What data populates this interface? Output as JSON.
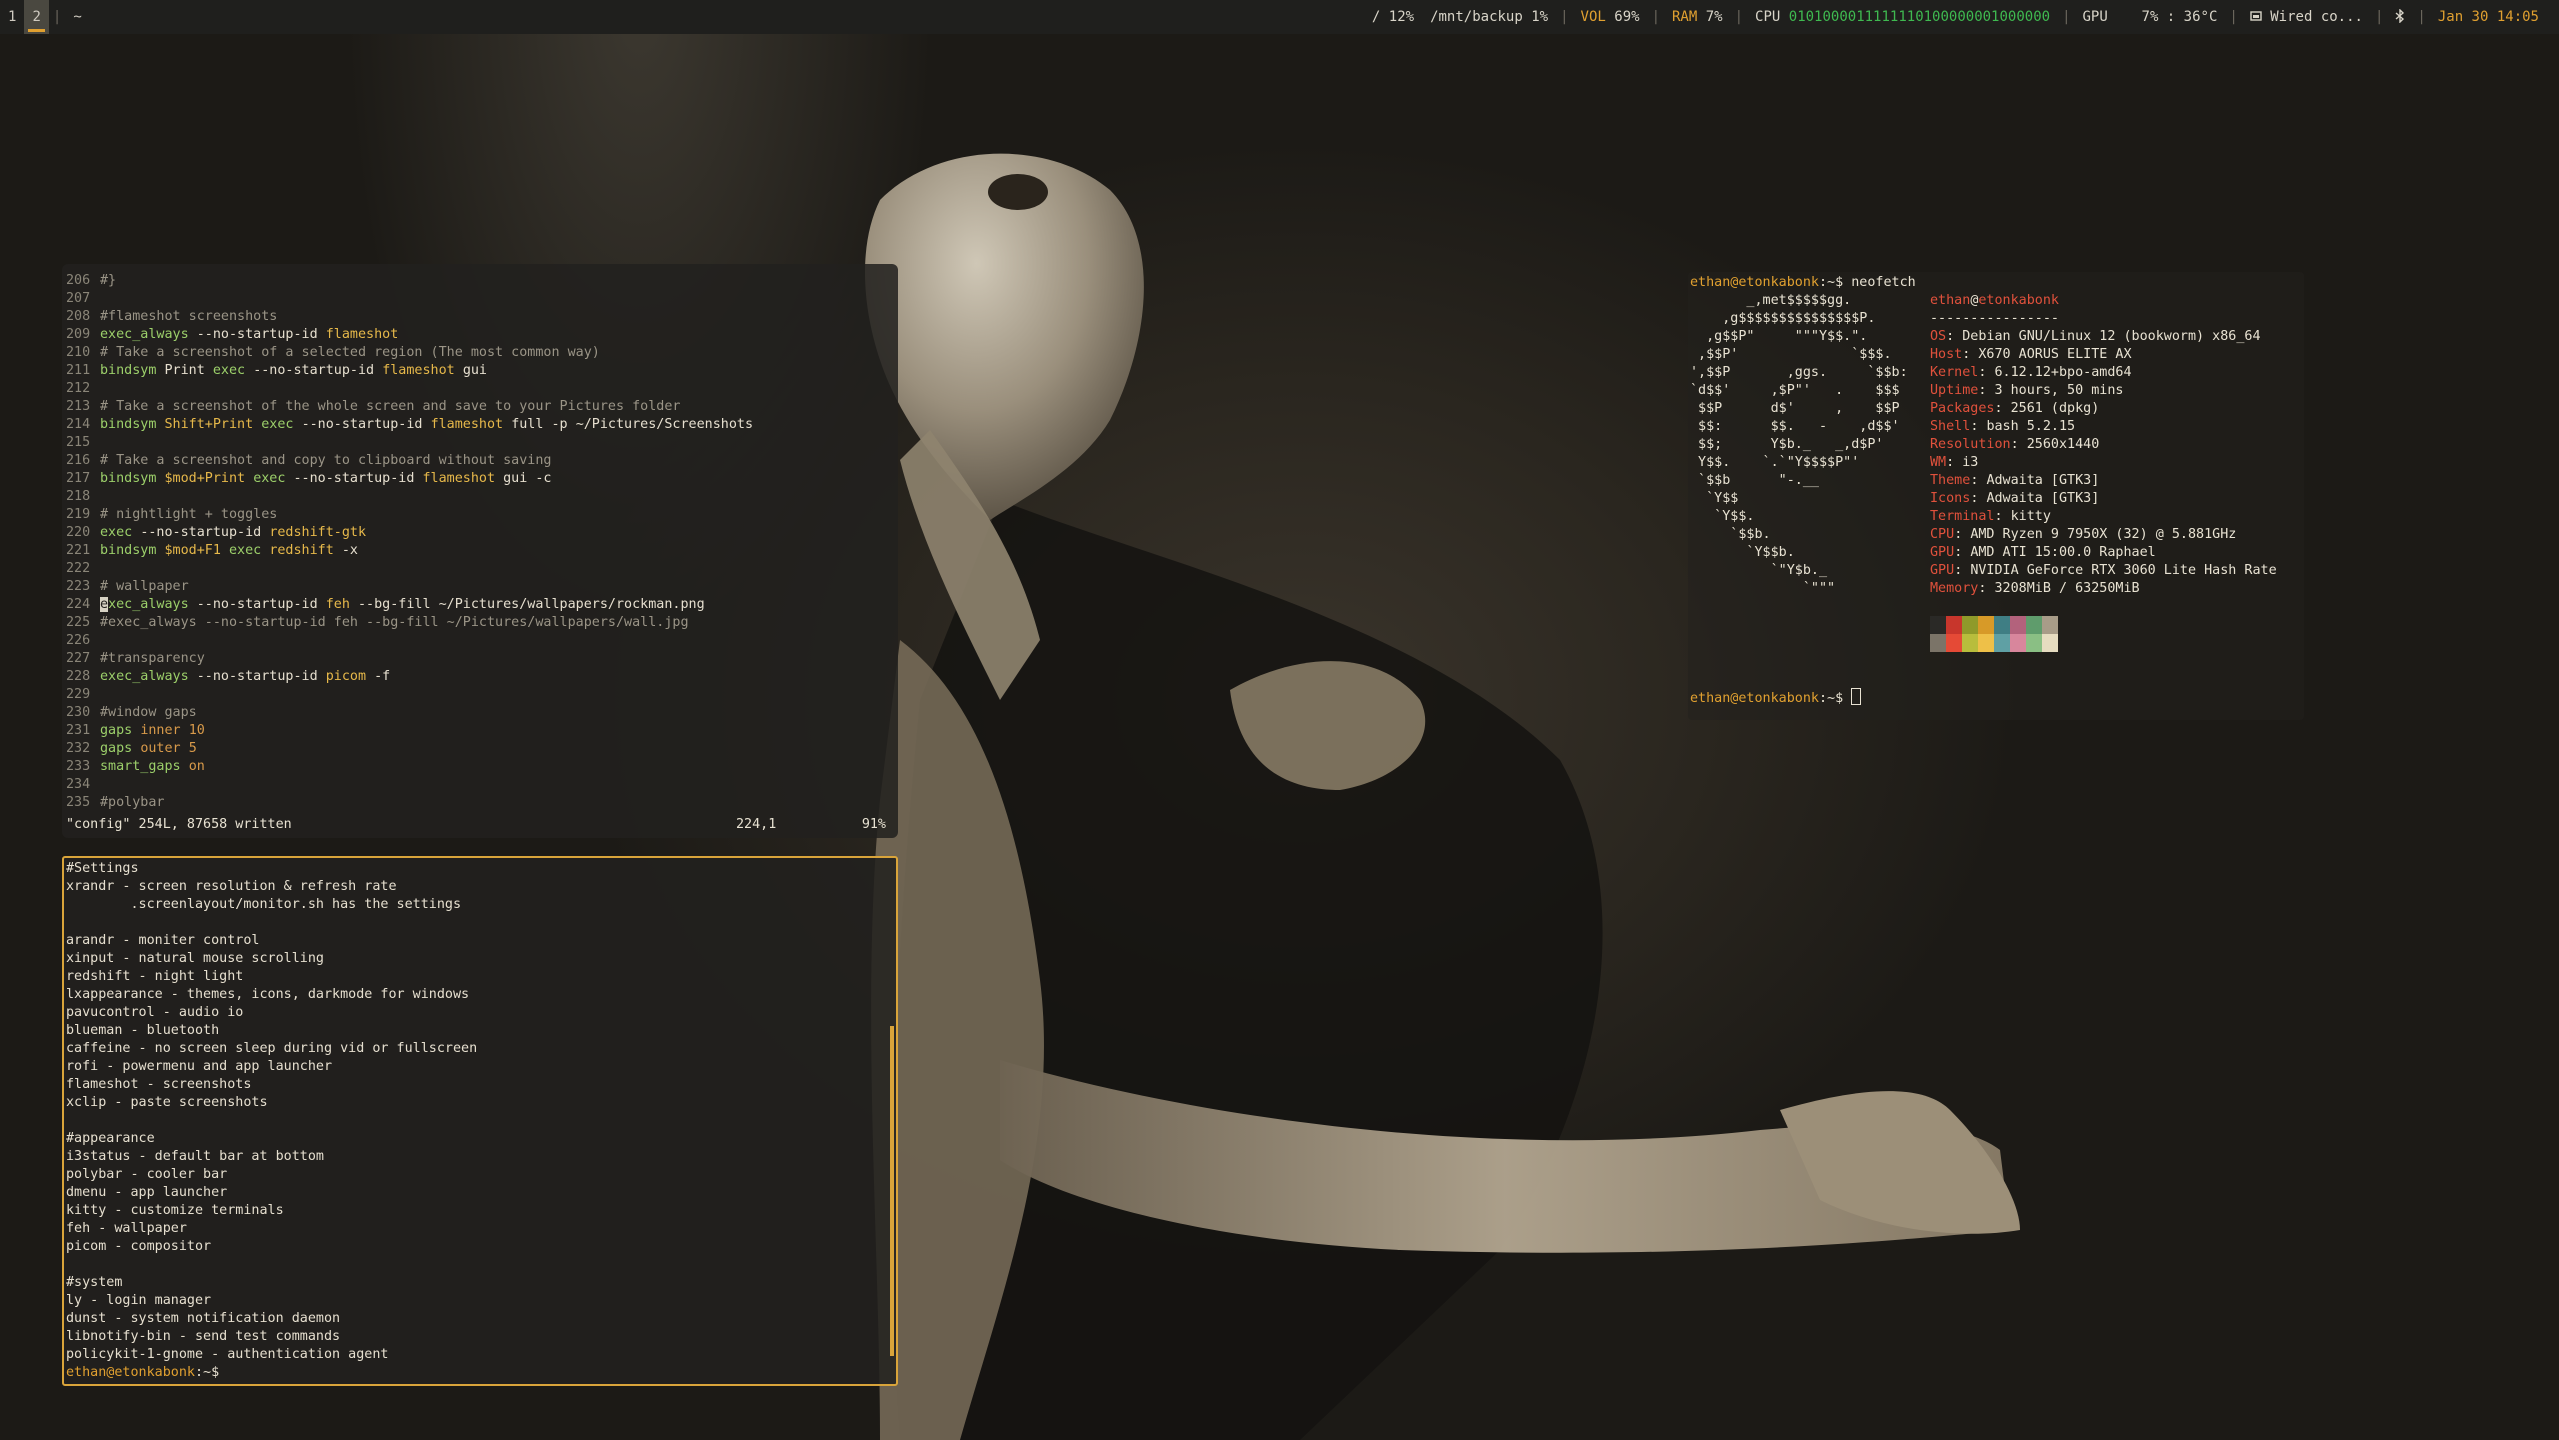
{
  "topbar": {
    "workspaces": [
      {
        "label": "1",
        "active": false
      },
      {
        "label": "2",
        "active": true
      }
    ],
    "separator": "|",
    "window_title": "~",
    "status": {
      "root_disk": "/ 12%",
      "backup_disk": "/mnt/backup 1%",
      "vol_label": "VOL",
      "vol_value": "69%",
      "ram_label": "RAM",
      "ram_value": "7%",
      "cpu_label": "CPU",
      "cpu_value": "0101000011111110100000001000000",
      "gpu_label": "GPU",
      "gpu_value": "7% : 36°C",
      "network": "Wired co...",
      "bluetooth_icon": "bluetooth-icon",
      "datetime": "Jan 30 14:05"
    }
  },
  "vim": {
    "lines": [
      {
        "n": "206",
        "t": "#}"
      },
      {
        "n": "207",
        "t": ""
      },
      {
        "n": "208",
        "t": "#flameshot screenshots"
      },
      {
        "n": "209",
        "t": "exec_always --no-startup-id flameshot"
      },
      {
        "n": "210",
        "t": "# Take a screenshot of a selected region (The most common way)"
      },
      {
        "n": "211",
        "t": "bindsym Print exec --no-startup-id flameshot gui"
      },
      {
        "n": "212",
        "t": ""
      },
      {
        "n": "213",
        "t": "# Take a screenshot of the whole screen and save to your Pictures folder"
      },
      {
        "n": "214",
        "t": "bindsym Shift+Print exec --no-startup-id flameshot full -p ~/Pictures/Screenshots"
      },
      {
        "n": "215",
        "t": ""
      },
      {
        "n": "216",
        "t": "# Take a screenshot and copy to clipboard without saving"
      },
      {
        "n": "217",
        "t": "bindsym $mod+Print exec --no-startup-id flameshot gui -c"
      },
      {
        "n": "218",
        "t": ""
      },
      {
        "n": "219",
        "t": "# nightlight + toggles"
      },
      {
        "n": "220",
        "t": "exec --no-startup-id redshift-gtk"
      },
      {
        "n": "221",
        "t": "bindsym $mod+F1 exec redshift -x"
      },
      {
        "n": "222",
        "t": ""
      },
      {
        "n": "223",
        "t": "# wallpaper"
      },
      {
        "n": "224",
        "t": "exec_always --no-startup-id feh --bg-fill ~/Pictures/wallpapers/rockman.png"
      },
      {
        "n": "225",
        "t": "#exec_always --no-startup-id feh --bg-fill ~/Pictures/wallpapers/wall.jpg"
      },
      {
        "n": "226",
        "t": ""
      },
      {
        "n": "227",
        "t": "#transparency"
      },
      {
        "n": "228",
        "t": "exec_always --no-startup-id picom -f"
      },
      {
        "n": "229",
        "t": ""
      },
      {
        "n": "230",
        "t": "#window gaps"
      },
      {
        "n": "231",
        "t": "gaps inner 10"
      },
      {
        "n": "232",
        "t": "gaps outer 5"
      },
      {
        "n": "233",
        "t": "smart_gaps on"
      },
      {
        "n": "234",
        "t": ""
      },
      {
        "n": "235",
        "t": "#polybar"
      }
    ],
    "status_message": "\"config\" 254L, 87658 written",
    "cursor_pos": "224,1",
    "scroll_percent": "91%"
  },
  "notes": {
    "lines": [
      "#Settings",
      "xrandr - screen resolution & refresh rate",
      "        .screenlayout/monitor.sh has the settings",
      "",
      "arandr - moniter control",
      "xinput - natural mouse scrolling",
      "redshift - night light",
      "lxappearance - themes, icons, darkmode for windows",
      "pavucontrol - audio io",
      "blueman - bluetooth",
      "caffeine - no screen sleep during vid or fullscreen",
      "rofi - powermenu and app launcher",
      "flameshot - screenshots",
      "xclip - paste screenshots",
      "",
      "#appearance",
      "i3status - default bar at bottom",
      "polybar - cooler bar",
      "dmenu - app launcher",
      "kitty - customize terminals",
      "feh - wallpaper",
      "picom - compositor",
      "",
      "#system",
      "ly - login manager",
      "dunst - system notification daemon",
      "libnotify-bin - send test commands",
      "policykit-1-gnome - authentication agent"
    ],
    "prompt_user": "ethan@etonkabonk",
    "prompt_suffix": ":~$"
  },
  "fetch": {
    "prompt_user": "ethan@etonkabonk",
    "prompt_suffix": ":~$ ",
    "command": "neofetch",
    "art": [
      "       _,met$$$$$gg.",
      "    ,g$$$$$$$$$$$$$$$P.",
      "  ,g$$P\"     \"\"\"Y$$.\".",
      " ,$$P'              `$$$.",
      "',$$P       ,ggs.     `$$b:",
      "`d$$'     ,$P\"'   .    $$$",
      " $$P      d$'     ,    $$P",
      " $$:      $$.   -    ,d$$'",
      " $$;      Y$b._   _,d$P'",
      " Y$$.    `.`\"Y$$$$P\"'",
      " `$$b      \"-.__",
      "  `Y$$",
      "   `Y$$.",
      "     `$$b.",
      "       `Y$$b.",
      "          `\"Y$b._",
      "              `\"\"\""
    ],
    "user": "ethan",
    "at": "@",
    "host": "etonkabonk",
    "divider": "----------------",
    "info": [
      {
        "label": "OS",
        "value": "Debian GNU/Linux 12 (bookworm) x86_64"
      },
      {
        "label": "Host",
        "value": "X670 AORUS ELITE AX"
      },
      {
        "label": "Kernel",
        "value": "6.12.12+bpo-amd64"
      },
      {
        "label": "Uptime",
        "value": "3 hours, 50 mins"
      },
      {
        "label": "Packages",
        "value": "2561 (dpkg)"
      },
      {
        "label": "Shell",
        "value": "bash 5.2.15"
      },
      {
        "label": "Resolution",
        "value": "2560x1440"
      },
      {
        "label": "WM",
        "value": "i3"
      },
      {
        "label": "Theme",
        "value": "Adwaita [GTK3]"
      },
      {
        "label": "Icons",
        "value": "Adwaita [GTK3]"
      },
      {
        "label": "Terminal",
        "value": "kitty"
      },
      {
        "label": "CPU",
        "value": "AMD Ryzen 9 7950X (32) @ 5.881GHz"
      },
      {
        "label": "GPU",
        "value": "AMD ATI 15:00.0 Raphael"
      },
      {
        "label": "GPU",
        "value": "NVIDIA GeForce RTX 3060 Lite Hash Rate"
      },
      {
        "label": "Memory",
        "value": "3208MiB / 63250MiB"
      }
    ],
    "palette_top": [
      "#2a2926",
      "#c8362c",
      "#8f9a2a",
      "#d79a28",
      "#3f7e84",
      "#b3627c",
      "#5f9c6c",
      "#a89c88"
    ],
    "palette_bottom": [
      "#7b7468",
      "#e54a36",
      "#b8bd3c",
      "#eec048",
      "#5fa0a4",
      "#d8869c",
      "#8abf84",
      "#e6dcc0"
    ]
  },
  "colors": {
    "accent": "#e0a030",
    "green": "#3fb950",
    "label_red": "#e0513c",
    "border": "#d9a43a"
  }
}
